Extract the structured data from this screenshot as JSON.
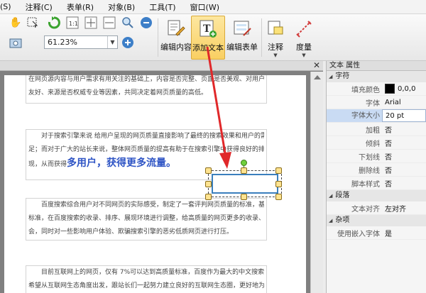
{
  "menu": [
    "(S)",
    "注释(C)",
    "表单(R)",
    "对象(B)",
    "工具(T)",
    "窗口(W)"
  ],
  "toolbar": {
    "zoom_value": "61.23%",
    "buttons": [
      "编辑内容",
      "添加文本",
      "编辑表单",
      "注释",
      "度量"
    ],
    "active_button": "添加文本"
  },
  "document": {
    "paragraphs": [
      [
        "在网页源内容与用户需求有用关注的基础上，内容是否完整、页面是否美观、对用户是否",
        "友好、来源是否权威专业等因素，共同决定着网页质量的高低。"
      ],
      [
        "对于搜索引擎来说 给用户呈现的网页质量直接影响了最终的搜索效果和用户的需求满",
        "足；而对于广大的站长来说，整体网页质量的提高有助于在搜索引擎中获得良好的排序和展"
      ],
      [
        "百度搜索综合用户对不同网页的实际感受，制定了一套评判网页质量的标准，基于这个",
        "标准，在百度搜索的收录、排序、展现环境进行调整，给高质量的网页更多的收录、展现机",
        "会，同时对一些影响用户体验、欺骗搜索引擎的恶劣低质网页进行打压。"
      ],
      [
        "目前互联网上的网页，仅有 7%可以达到高质量标准，百度作为最大的中文搜索引擎，",
        "希望从互联网生态角度出发，跟站长们一起努力建立良好的互联网生态圈，更好地为网民服"
      ]
    ],
    "para2_line3_prefix": "现，从而获得",
    "para2_line3_big": "多用户，获得更多流量。"
  },
  "properties": {
    "title": "文本 属性",
    "sections": [
      {
        "name": "字符",
        "rows": [
          {
            "key": "填充颜色",
            "value": "0,0,0",
            "swatch": "#000000"
          },
          {
            "key": "字体",
            "value": "Arial"
          },
          {
            "key": "字体大小",
            "value": "20 pt",
            "highlight": true
          },
          {
            "key": "加粗",
            "value": "否"
          },
          {
            "key": "倾斜",
            "value": "否"
          },
          {
            "key": "下划线",
            "value": "否"
          },
          {
            "key": "删除线",
            "value": "否"
          },
          {
            "key": "脚本样式",
            "value": "否"
          }
        ]
      },
      {
        "name": "段落",
        "rows": [
          {
            "key": "文本对齐",
            "value": "左对齐"
          }
        ]
      },
      {
        "name": "杂项",
        "rows": [
          {
            "key": "使用嵌入字体",
            "value": "是"
          }
        ]
      }
    ]
  },
  "colors": {
    "accent": "#2f55c5",
    "arrow": "#e0282a",
    "active_button": "#f9cf62"
  }
}
